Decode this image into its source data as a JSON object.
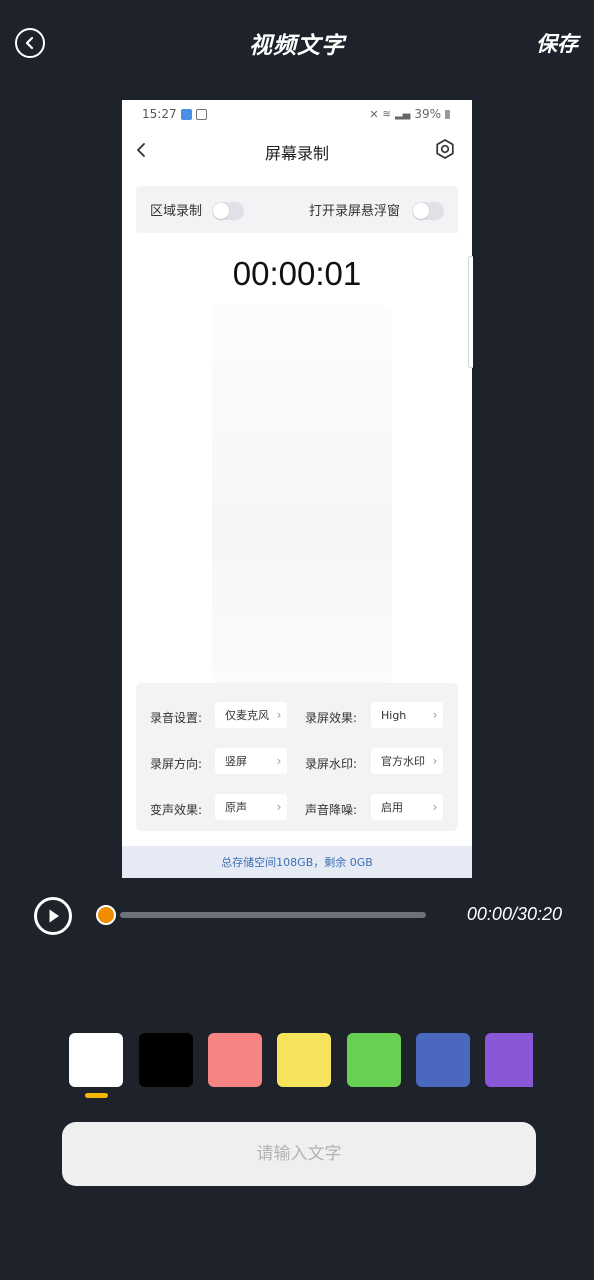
{
  "header": {
    "title": "视频文字",
    "save_label": "保存"
  },
  "preview": {
    "status_time": "15:27",
    "battery": "39%",
    "page_title": "屏幕录制",
    "toggles": [
      {
        "label": "区域录制",
        "on": false
      },
      {
        "label": "打开录屏悬浮窗",
        "on": false
      }
    ],
    "timer": "00:00:01",
    "settings": [
      {
        "label": "录音设置:",
        "value": "仅麦克风"
      },
      {
        "label": "录屏效果:",
        "value": "High"
      },
      {
        "label": "录屏方向:",
        "value": "竖屏"
      },
      {
        "label": "录屏水印:",
        "value": "官方水印"
      },
      {
        "label": "变声效果:",
        "value": "原声"
      },
      {
        "label": "声音降噪:",
        "value": "启用"
      }
    ],
    "storage_text": "总存储空间108GB，剩余 0GB"
  },
  "player": {
    "time": "00:00/30:20",
    "progress": 0
  },
  "palette": {
    "colors": [
      "#ffffff",
      "#000000",
      "#f78383",
      "#f7e45c",
      "#66d153",
      "#4a68bf",
      "#8a57d8"
    ],
    "selected": 0
  },
  "text_input": {
    "placeholder": "请输入文字"
  }
}
